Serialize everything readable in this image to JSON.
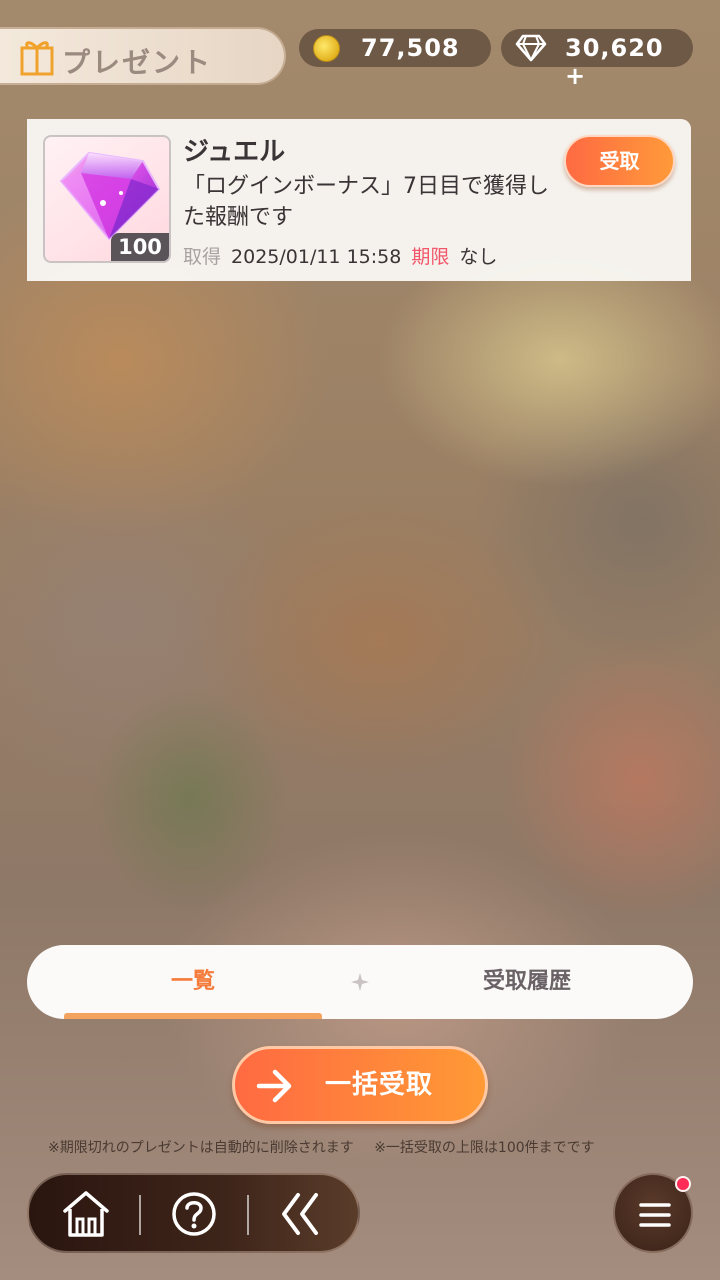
{
  "header": {
    "title": "プレゼント",
    "title_icon": "gift-box-icon",
    "coins": {
      "icon": "coin-icon",
      "value": "77,508"
    },
    "jewels": {
      "icon": "diamond-icon",
      "value": "30,620 +"
    }
  },
  "presents": [
    {
      "name": "ジュエル",
      "icon": "jewel-item-icon",
      "quantity": "100",
      "description": "「ログインボーナス」7日目で獲得した報酬です",
      "acquired_label": "取得",
      "acquired_value": "2025/01/11 15:58",
      "limit_label": "期限",
      "limit_value": "なし",
      "receive_label": "受取"
    }
  ],
  "tabs": {
    "list_label": "一覧",
    "history_label": "受取履歴",
    "active": "list"
  },
  "bulk_receive": {
    "label": "一括受取",
    "icon": "arrow-right-icon"
  },
  "notes": {
    "expired_note": "※期限切れのプレゼントは自動的に削除されます",
    "limit_note": "※一括受取の上限は100件までです"
  },
  "bottom_nav": {
    "items": [
      "home-icon",
      "help-icon",
      "back-icon"
    ],
    "menu_icon": "menu-icon",
    "menu_has_notification": true
  },
  "colors": {
    "accent_orange": "#ff7a3d",
    "tab_active": "#f47b3a",
    "limit_red": "#f2566b",
    "nav_dark": "#2a150f",
    "notification": "#ff2d55"
  }
}
